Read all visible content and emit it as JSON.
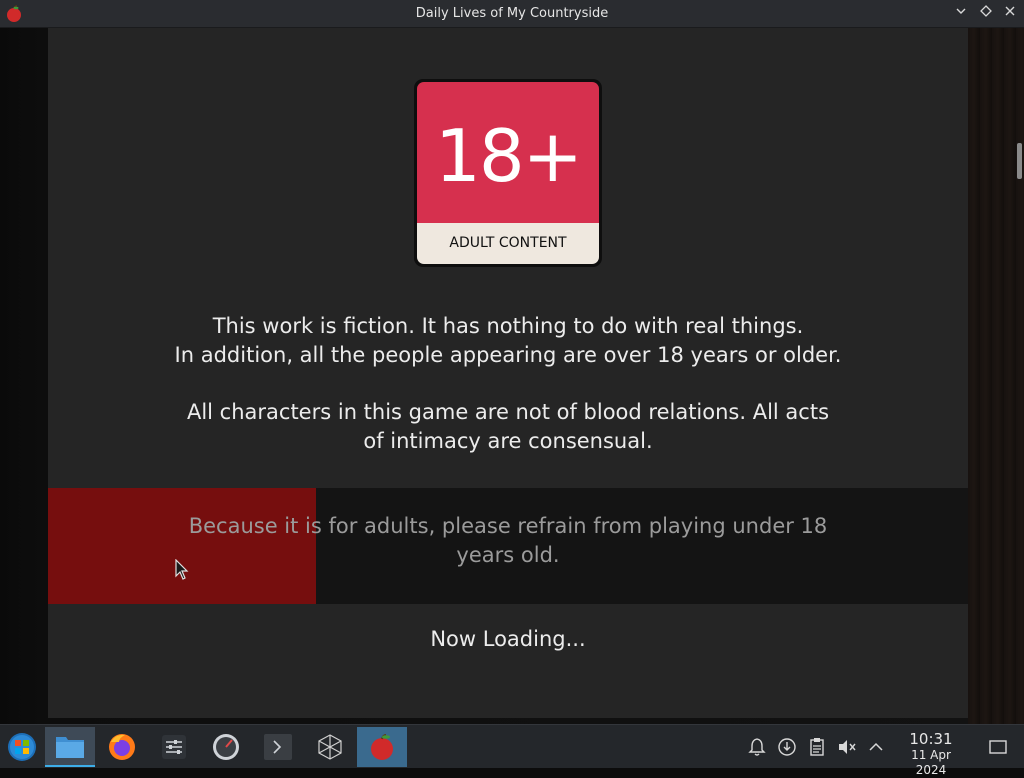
{
  "window": {
    "title": "Daily Lives of My Countryside"
  },
  "badge": {
    "rating": "18+",
    "label": "ADULT CONTENT"
  },
  "disclaimer": {
    "line1": "This work is fiction. It has nothing to do with real things.",
    "line2": "In addition, all the people appearing are over 18 years or older.",
    "line3": "All characters in this game are not of blood relations. All acts",
    "line4": "of intimacy are consensual."
  },
  "warning": {
    "line1": "Because it is for adults, please refrain from playing under 18",
    "line2": "years old."
  },
  "loading_text": "Now Loading...",
  "colors": {
    "badge_red": "#d6304e",
    "progress_red": "#760e0e",
    "taskbar_accent": "#3daee9"
  },
  "taskbar": {
    "items": [
      "start-menu",
      "file-manager",
      "firefox",
      "system-settings",
      "disk-usage",
      "terminal",
      "box-app",
      "game-app"
    ],
    "clock": {
      "time": "10:31",
      "date": "11 Apr 2024"
    }
  }
}
